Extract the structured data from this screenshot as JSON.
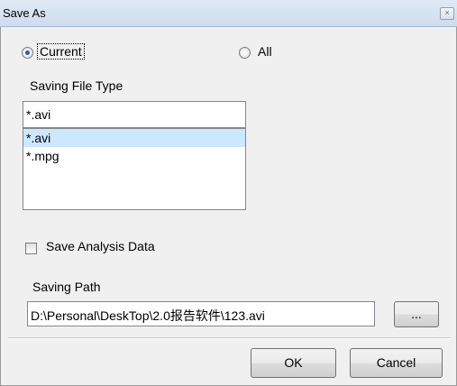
{
  "window": {
    "title": "Save As",
    "close_glyph": "×"
  },
  "scope": {
    "current_label": "Current",
    "all_label": "All",
    "selected": "Current"
  },
  "file_type": {
    "label": "Saving File Type",
    "value": "*.avi",
    "options": [
      "*.avi",
      "*.mpg"
    ],
    "selected_index": 0
  },
  "analysis": {
    "label": "Save Analysis Data",
    "checked": false
  },
  "path": {
    "label": "Saving Path",
    "value": "D:\\Personal\\DeskTop\\2.0报告软件\\123.avi",
    "browse_label": "..."
  },
  "buttons": {
    "ok": "OK",
    "cancel": "Cancel"
  }
}
